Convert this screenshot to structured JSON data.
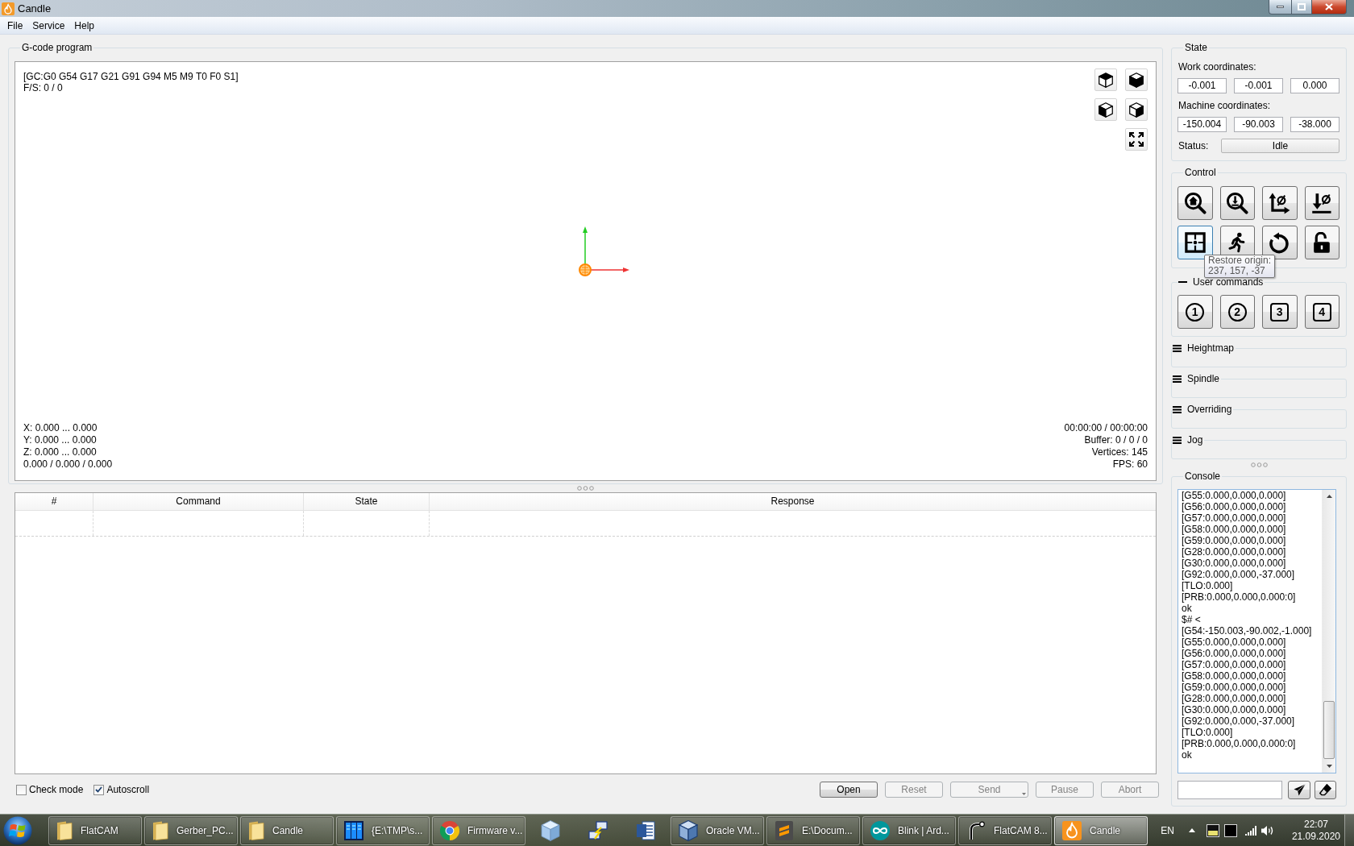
{
  "window": {
    "title": "Candle"
  },
  "menu": [
    {
      "label": "File"
    },
    {
      "label": "Service"
    },
    {
      "label": "Help"
    }
  ],
  "gcode_program": {
    "title": "G-code program",
    "parser_state": "[GC:G0 G54 G17 G21 G91 G94 M5 M9 T0 F0 S1]",
    "feed_spindle": "F/S: 0 / 0",
    "bounds": [
      "X: 0.000 ... 0.000",
      "Y: 0.000 ... 0.000",
      "Z: 0.000 ... 0.000",
      "0.000 / 0.000 / 0.000"
    ],
    "stats": [
      "00:00:00 / 00:00:00",
      "Buffer: 0 / 0 / 0",
      "Vertices: 145",
      "FPS: 60"
    ]
  },
  "table": {
    "columns": [
      "#",
      "Command",
      "State",
      "Response"
    ]
  },
  "options": [
    {
      "label": "Check mode",
      "checked": false
    },
    {
      "label": "Autoscroll",
      "checked": true
    }
  ],
  "buttons": [
    {
      "label": "Open",
      "kind": "push",
      "disabled": false
    },
    {
      "label": "Reset",
      "kind": "push",
      "disabled": true
    },
    {
      "label": "Send",
      "kind": "menu",
      "disabled": true
    },
    {
      "label": "Pause",
      "kind": "push",
      "disabled": true
    },
    {
      "label": "Abort",
      "kind": "push",
      "disabled": true
    }
  ],
  "state": {
    "title": "State",
    "work_label": "Work coordinates:",
    "work": [
      "-0.001",
      "-0.001",
      "0.000"
    ],
    "machine_label": "Machine coordinates:",
    "machine": [
      "-150.004",
      "-90.003",
      "-38.000"
    ],
    "status_label": "Status:",
    "status": "Idle"
  },
  "control": {
    "title": "Control",
    "buttons": [
      {
        "hovered": false
      },
      {
        "hovered": false
      },
      {
        "hovered": false
      },
      {
        "hovered": false
      },
      {
        "hovered": true
      },
      {
        "hovered": false
      },
      {
        "hovered": false
      },
      {
        "hovered": false
      }
    ]
  },
  "tooltip": {
    "lines": [
      "Restore origin:",
      "237, 157, -37"
    ]
  },
  "user_commands": {
    "title": "User commands",
    "expanded": true,
    "buttons": [
      {
        "label": "1",
        "kind": "circle"
      },
      {
        "label": "2",
        "kind": "circle"
      },
      {
        "label": "3",
        "kind": "square"
      },
      {
        "label": "4",
        "kind": "square"
      }
    ]
  },
  "panels": [
    {
      "title": "Heightmap",
      "expanded": false
    },
    {
      "title": "Spindle",
      "expanded": false
    },
    {
      "title": "Overriding",
      "expanded": false
    },
    {
      "title": "Jog",
      "expanded": false
    }
  ],
  "console": {
    "title": "Console",
    "lines": [
      "[G55:0.000,0.000,0.000]",
      "[G56:0.000,0.000,0.000]",
      "[G57:0.000,0.000,0.000]",
      "[G58:0.000,0.000,0.000]",
      "[G59:0.000,0.000,0.000]",
      "[G28:0.000,0.000,0.000]",
      "[G30:0.000,0.000,0.000]",
      "[G92:0.000,0.000,-37.000]",
      "[TLO:0.000]",
      "[PRB:0.000,0.000,0.000:0]",
      "ok",
      "$# <",
      "[G54:-150.003,-90.002,-1.000]",
      "[G55:0.000,0.000,0.000]",
      "[G56:0.000,0.000,0.000]",
      "[G57:0.000,0.000,0.000]",
      "[G58:0.000,0.000,0.000]",
      "[G59:0.000,0.000,0.000]",
      "[G28:0.000,0.000,0.000]",
      "[G30:0.000,0.000,0.000]",
      "[G92:0.000,0.000,-37.000]",
      "[TLO:0.000]",
      "[PRB:0.000,0.000,0.000:0]",
      "ok"
    ]
  },
  "taskbar": {
    "items": [
      {
        "label": "FlatCAM",
        "selected": false
      },
      {
        "label": "Gerber_PC...",
        "selected": false
      },
      {
        "label": "Candle",
        "selected": false
      },
      {
        "label": "{E:\\TMP\\s...",
        "selected": false
      },
      {
        "label": "Firmware v...",
        "selected": false
      },
      {
        "selected": false
      },
      {
        "selected": false
      },
      {
        "selected": false
      },
      {
        "label": "Oracle VM...",
        "selected": false
      },
      {
        "label": "E:\\Docum...",
        "selected": false
      },
      {
        "label": "Blink | Ard...",
        "selected": false
      },
      {
        "label": "FlatCAM 8...",
        "selected": false
      },
      {
        "label": "Candle",
        "selected": true
      }
    ],
    "language": "EN",
    "time": "22:07",
    "date": "21.09.2020"
  }
}
